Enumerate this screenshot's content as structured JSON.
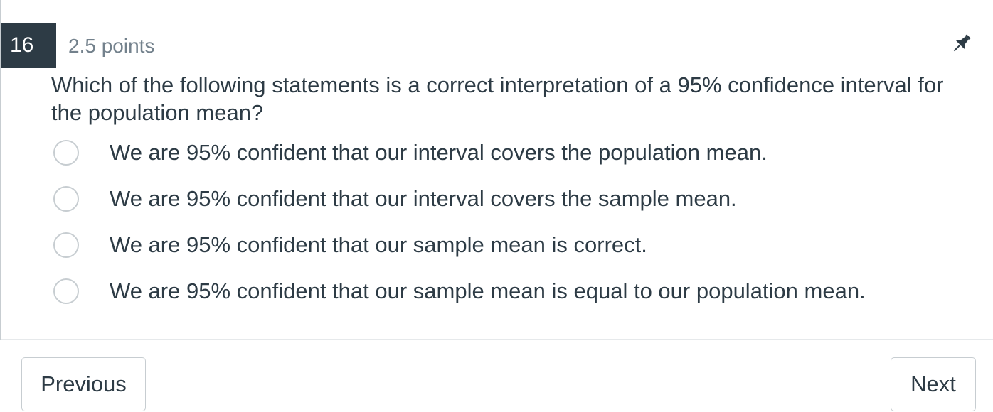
{
  "question": {
    "number": "16",
    "points": "2.5 points",
    "text": "Which of the following statements is a correct interpretation of a 95% confidence interval for the population mean?",
    "pin_icon": "thumbtack-icon"
  },
  "answers": [
    {
      "label": "We are 95% confident that our interval covers the population mean.",
      "selected": false
    },
    {
      "label": "We are 95% confident that our interval covers the sample mean.",
      "selected": false
    },
    {
      "label": "We are 95% confident that our sample mean is correct.",
      "selected": false
    },
    {
      "label": "We are 95% confident that our sample mean is equal to our population mean.",
      "selected": false
    }
  ],
  "navigation": {
    "previous_label": "Previous",
    "next_label": "Next"
  },
  "colors": {
    "question_number_bg": "#2d3b45",
    "text": "#2d3b45",
    "muted_text": "#73818c",
    "border": "#c7cdd1"
  }
}
